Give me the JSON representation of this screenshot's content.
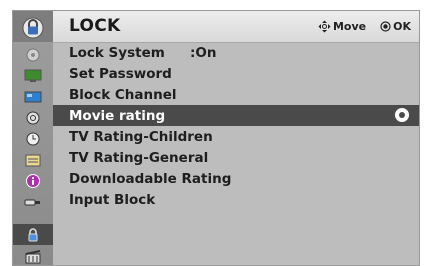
{
  "header": {
    "title": "LOCK",
    "move_label": "Move",
    "ok_label": "OK"
  },
  "sidebar": {
    "items": [
      {
        "icon": "picture-icon"
      },
      {
        "icon": "screen-icon"
      },
      {
        "icon": "channel-icon"
      },
      {
        "icon": "audio-icon"
      },
      {
        "icon": "clock-icon"
      },
      {
        "icon": "option-icon"
      },
      {
        "icon": "info-icon"
      },
      {
        "icon": "input-icon"
      },
      {
        "icon": "lock-icon",
        "selected": true
      },
      {
        "icon": "media-icon"
      }
    ]
  },
  "menu": {
    "items": [
      {
        "label": "Lock System",
        "value": ":On"
      },
      {
        "label": "Set Password"
      },
      {
        "label": "Block Channel"
      },
      {
        "label": "Movie rating",
        "selected": true
      },
      {
        "label": "TV Rating-Children"
      },
      {
        "label": "TV Rating-General"
      },
      {
        "label": "Downloadable Rating"
      },
      {
        "label": "Input Block"
      }
    ]
  },
  "colors": {
    "selected_bg": "#4a4a4a",
    "panel_bg": "#bdbdbd"
  }
}
